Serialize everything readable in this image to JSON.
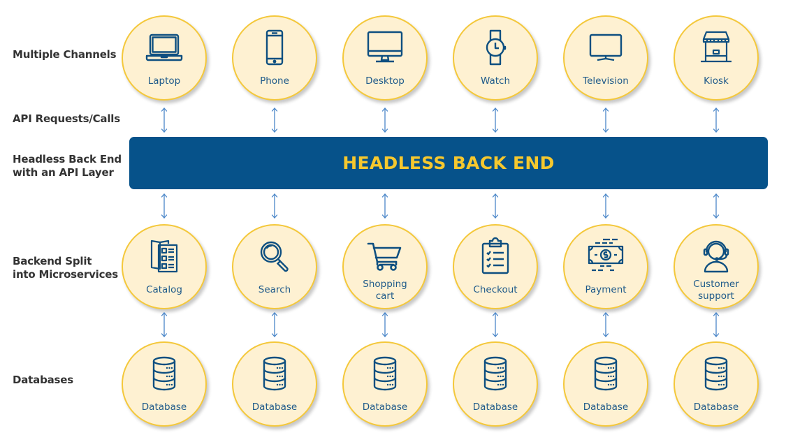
{
  "colors": {
    "node_fill": "#fef1d2",
    "node_border": "#f4c83b",
    "icon_stroke": "#0e4f80",
    "node_label": "#1f5a8a",
    "bar_fill": "#06528a",
    "bar_text": "#f6c82e",
    "arrow": "#4a86c8",
    "row_label": "#333333"
  },
  "row_labels": {
    "channels": "Multiple Channels",
    "api": "API Requests/Calls",
    "backend_line1": "Headless Back End",
    "backend_line2": "with an API Layer",
    "micro_line1": "Backend Split",
    "micro_line2": "into Microservices",
    "databases": "Databases"
  },
  "backend_bar": {
    "label": "HEADLESS BACK END"
  },
  "channels": [
    {
      "label": "Laptop",
      "icon": "laptop-icon"
    },
    {
      "label": "Phone",
      "icon": "phone-icon"
    },
    {
      "label": "Desktop",
      "icon": "desktop-icon"
    },
    {
      "label": "Watch",
      "icon": "watch-icon"
    },
    {
      "label": "Television",
      "icon": "television-icon"
    },
    {
      "label": "Kiosk",
      "icon": "kiosk-icon"
    }
  ],
  "microservices": [
    {
      "label": "Catalog",
      "icon": "catalog-icon"
    },
    {
      "label": "Search",
      "icon": "search-icon"
    },
    {
      "label": "Shopping cart",
      "line1": "Shopping",
      "line2": "cart",
      "icon": "shopping-cart-icon"
    },
    {
      "label": "Checkout",
      "icon": "checkout-clipboard-icon"
    },
    {
      "label": "Payment",
      "icon": "payment-banknote-icon"
    },
    {
      "label": "Customer support",
      "line1": "Customer",
      "line2": "support",
      "icon": "customer-support-headset-icon"
    }
  ],
  "databases": [
    {
      "label": "Database",
      "icon": "database-icon"
    },
    {
      "label": "Database",
      "icon": "database-icon"
    },
    {
      "label": "Database",
      "icon": "database-icon"
    },
    {
      "label": "Database",
      "icon": "database-icon"
    },
    {
      "label": "Database",
      "icon": "database-icon"
    },
    {
      "label": "Database",
      "icon": "database-icon"
    }
  ],
  "connections": [
    {
      "from": "channels",
      "to": "backend",
      "type": "bidirectional"
    },
    {
      "from": "backend",
      "to": "microservices",
      "type": "bidirectional"
    },
    {
      "from": "microservices",
      "to": "databases",
      "type": "bidirectional"
    }
  ]
}
